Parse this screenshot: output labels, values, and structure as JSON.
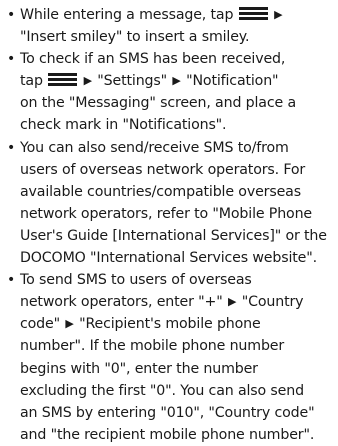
{
  "bullet_glyph": "•",
  "arrow_glyph": "▶",
  "icons": {
    "menu_key": "menu-key-icon"
  },
  "colors": {
    "text": "#1a1a1a",
    "icon": "#1a1a1a"
  },
  "item1": {
    "l1a": "While entering a message, tap",
    "l2": "\"Insert smiley\" to insert a smiley."
  },
  "item2": {
    "l1": "To check if an SMS has been received,",
    "l2a": "tap",
    "l2b": "\"Settings\"",
    "l2c": "\"Notification\"",
    "l3": "on the \"Messaging\" screen, and place a",
    "l4": "check mark in \"Notifications\"."
  },
  "item3": {
    "l1": "You can also send/receive SMS to/from",
    "l2": "users of overseas network operators. For",
    "l3": "available countries/compatible overseas",
    "l4": "network operators, refer to \"Mobile Phone",
    "l5": "User's Guide [International Services]\" or the",
    "l6": "DOCOMO \"International Services website\"."
  },
  "item4": {
    "l1": "To send SMS to users of overseas",
    "l2a": "network operators, enter \"+\"",
    "l2b": "\"Country",
    "l3a": "code\"",
    "l3b": "\"Recipient's mobile phone",
    "l4": "number\". If the mobile phone number",
    "l5": "begins with \"0\", enter the number",
    "l6": "excluding the first \"0\". You can also send",
    "l7": "an SMS by entering \"010\", \"Country code\"",
    "l8": "and \"the recipient mobile phone number\"."
  }
}
